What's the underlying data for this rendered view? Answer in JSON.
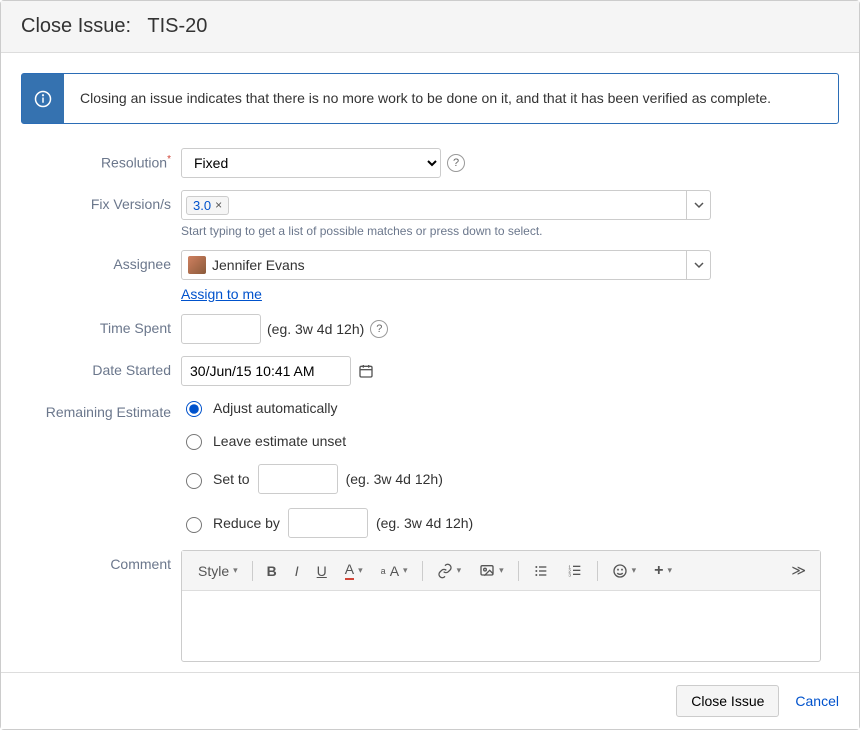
{
  "dialog": {
    "title_prefix": "Close Issue:",
    "issue_key": "TIS-20"
  },
  "banner": {
    "text": "Closing an issue indicates that there is no more work to be done on it, and that it has been verified as complete."
  },
  "labels": {
    "resolution": "Resolution",
    "fix_versions": "Fix Version/s",
    "assignee": "Assignee",
    "time_spent": "Time Spent",
    "date_started": "Date Started",
    "remaining_estimate": "Remaining Estimate",
    "comment": "Comment"
  },
  "resolution": {
    "value": "Fixed"
  },
  "fix_versions": {
    "chips": [
      "3.0"
    ],
    "hint": "Start typing to get a list of possible matches or press down to select."
  },
  "assignee": {
    "name": "Jennifer Evans",
    "assign_to_me": "Assign to me"
  },
  "time_spent": {
    "value": "",
    "example": "(eg. 3w 4d 12h)"
  },
  "date_started": {
    "value": "30/Jun/15 10:41 AM"
  },
  "remaining_estimate": {
    "options": {
      "adjust": "Adjust automatically",
      "leave": "Leave estimate unset",
      "set_to": "Set to",
      "reduce_by": "Reduce by"
    },
    "example": "(eg. 3w 4d 12h)",
    "selected": "adjust"
  },
  "toolbar": {
    "style": "Style"
  },
  "footer": {
    "close": "Close Issue",
    "cancel": "Cancel"
  }
}
